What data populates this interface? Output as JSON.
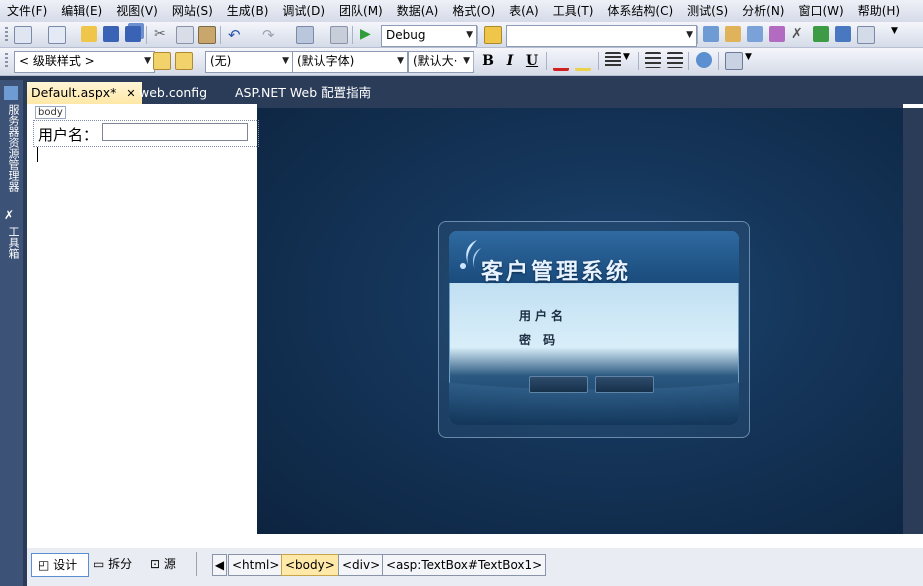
{
  "menu": [
    "文件(F)",
    "编辑(E)",
    "视图(V)",
    "网站(S)",
    "生成(B)",
    "调试(D)",
    "团队(M)",
    "数据(A)",
    "格式(O)",
    "表(A)",
    "工具(T)",
    "体系结构(C)",
    "测试(S)",
    "分析(N)",
    "窗口(W)",
    "帮助(H)"
  ],
  "toolbar1": {
    "config_value": "Debug",
    "search_value": ""
  },
  "toolbar2": {
    "style_value": "< 级联样式 >",
    "block_value": "(无)",
    "font_value": "(默认字体)",
    "size_value": "(默认大·",
    "bold": "B",
    "italic": "I",
    "underline": "U"
  },
  "side_tabs": [
    "服务器资源管理器",
    "工具箱"
  ],
  "tabs": [
    {
      "label": "Default.aspx*",
      "close": "✕"
    },
    {
      "label": "web.config"
    },
    {
      "label": "ASP.NET Web 配置指南"
    }
  ],
  "design": {
    "body_tag": "body",
    "username_label": "用户名：",
    "username_value": ""
  },
  "login_panel": {
    "title": "客户管理系统",
    "user_label": "用户名",
    "password_label": "密 码"
  },
  "view_buttons": [
    "设计",
    "拆分",
    "源"
  ],
  "breadcrumbs": [
    "<html>",
    "<body>",
    "<div>",
    "<asp:TextBox#TextBox1>"
  ],
  "colors": {
    "tab_active": "#ffe8a6",
    "chrome": "#2b3c59",
    "accent_play": "#2e9d3a"
  }
}
